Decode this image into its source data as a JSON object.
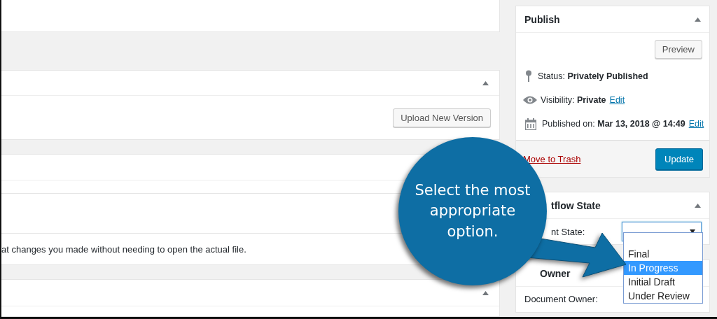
{
  "upload_panel": {
    "button": "Upload New Version"
  },
  "description_panel": {
    "text": "at changes you made without needing to open the actual file."
  },
  "publish": {
    "title": "Publish",
    "preview": "Preview",
    "status": "Status: **Privately Published**",
    "visibility": "Visibility: **Private**",
    "visibility_edit": "Edit",
    "published": "Published on: **Mar 13, 2018 @ 14:49**",
    "published_edit": "Edit",
    "trash": "Move to Trash",
    "update": "Update"
  },
  "workflow": {
    "title": "tflow State",
    "field_label": "nt State:",
    "select": {
      "expanded": true
    },
    "options": [
      {
        "label": "Final",
        "selected": false
      },
      {
        "label": "In Progress",
        "selected": true
      },
      {
        "label": "Initial Draft",
        "selected": false
      },
      {
        "label": "Under Review",
        "selected": false
      }
    ]
  },
  "owner": {
    "title": "Owner",
    "field_label": "Document Owner:"
  },
  "callout": {
    "text": "Select the most appropriate option."
  }
}
